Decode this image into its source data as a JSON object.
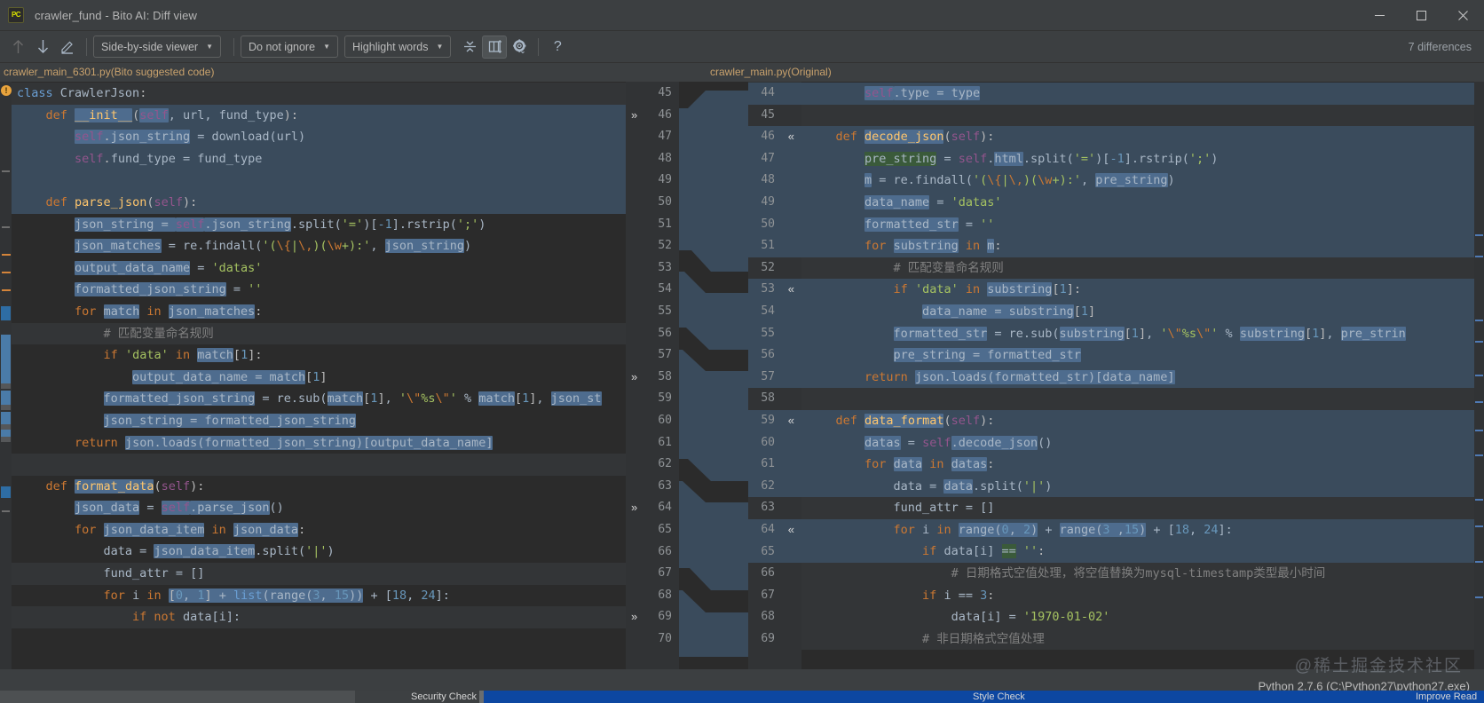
{
  "window": {
    "title": "crawler_fund - Bito AI: Diff view",
    "app_icon": "pycharm-icon",
    "minimize": "minimize-icon",
    "maximize": "maximize-icon",
    "close": "close-icon"
  },
  "toolbar": {
    "prev_diff": "arrow-up-icon",
    "next_diff": "arrow-down-icon",
    "edit": "pencil-icon",
    "viewer_mode": "Side-by-side viewer",
    "ignore_mode": "Do not ignore",
    "highlight_mode": "Highlight words",
    "collapse_unchanged": "collapse-icon",
    "toggle_panes": "columns-icon",
    "settings": "gear-icon",
    "help": "?",
    "differences": "7 differences",
    "caret": "▼"
  },
  "files": {
    "left": "crawler_main_6301.py(Bito suggested code)",
    "right": "crawler_main.py(Original)"
  },
  "status": {
    "interpreter": "Python 2.7.6 (C:\\Python27\\python27.exe)",
    "watermark": "@稀土掘金技术社区",
    "bottom_items": [
      "Security Check",
      "Style Check",
      "Improve Read"
    ]
  },
  "left_pane": {
    "lines": [
      {
        "n": "",
        "bg": "bg-ign",
        "html": "<span class='kw2'>class</span> <span class='id'>CrawlerJson</span>:"
      },
      {
        "n": "",
        "bg": "bg-add",
        "html": "    <span class='kw'>def</span> <span class='hl fn'>__init__</span>(<span class='hl self'>self</span><span class='id'>, url, fund_type</span>):"
      },
      {
        "n": "",
        "bg": "bg-add",
        "html": "        <span class='hl'><span class='self'>self</span>.<span class='id'>json_string</span></span> <span class='id'>= download(url)</span>"
      },
      {
        "n": "",
        "bg": "bg-add",
        "html": "        <span class='self'>self</span>.<span class='id'>fund_type = fund_type</span>"
      },
      {
        "n": "",
        "bg": "bg-add",
        "html": ""
      },
      {
        "n": "",
        "bg": "bg-add",
        "html": "    <span class='kw'>def</span> <span class='fn'>parse_json</span>(<span class='self'>self</span>):"
      },
      {
        "n": "",
        "bg": "bg-none",
        "html": "        <span class='hl id'>json_string = </span><span class='hl self'>self</span><span class='hl id'>.json_string</span><span class='id'>.split(</span><span class='str'>'='</span><span class='id'>)[</span><span class='num'>-1</span><span class='id'>].rstrip(</span><span class='str'>';'</span><span class='id'>)</span>"
      },
      {
        "n": "",
        "bg": "bg-none",
        "html": "        <span class='hl id'>json_matches</span> <span class='id'>= re.findall(</span><span class='str'>'(</span><span class='esc'>\\{</span><span class='str'>|</span><span class='esc'>\\,</span><span class='str'>)(</span><span class='esc'>\\w</span><span class='str'>+):'</span><span class='id'>, </span><span class='hl id'>json_string</span><span class='id'>)</span>"
      },
      {
        "n": "",
        "bg": "bg-none",
        "html": "        <span class='hl id'>output_data_name</span><span class='id'> = </span><span class='str'>'datas'</span>"
      },
      {
        "n": "",
        "bg": "bg-none",
        "html": "        <span class='hl id'>formatted_json_string</span><span class='id'> = </span><span class='str'>''</span>"
      },
      {
        "n": "",
        "bg": "bg-none",
        "html": "        <span class='kw'>for</span> <span class='hl id'>match</span> <span class='kw'>in</span> <span class='hl id'>json_matches</span>:"
      },
      {
        "n": "",
        "bg": "bg-ign",
        "html": "            <span class='cm'># 匹配变量命名规则</span>"
      },
      {
        "n": "",
        "bg": "bg-none",
        "html": "            <span class='kw'>if</span> <span class='str'>'data'</span> <span class='kw'>in</span> <span class='hl id'>match</span>[<span class='num'>1</span>]:"
      },
      {
        "n": "",
        "bg": "bg-none",
        "html": "                <span class='hl id'>output_data_name = match</span>[<span class='num'>1</span>]"
      },
      {
        "n": "",
        "bg": "bg-none",
        "html": "            <span class='hl id'>formatted_json_string</span><span class='id'> = re.sub(</span><span class='hl id'>match</span>[<span class='num'>1</span>]<span class='id'>, </span><span class='str'>'</span><span class='esc'>\\\"</span><span class='str'>%s</span><span class='esc'>\\\"</span><span class='str'>'</span><span class='id'> % </span><span class='hl id'>match</span>[<span class='num'>1</span>]<span class='id'>, </span><span class='hl id'>json_st</span>"
      },
      {
        "n": "",
        "bg": "bg-none",
        "html": "            <span class='hl id'>json_string = formatted_json_string</span>"
      },
      {
        "n": "",
        "bg": "bg-none",
        "html": "        <span class='kw'>return</span> <span class='hl id'>json.loads(formatted_json_string)[output_data_name]</span>"
      },
      {
        "n": "",
        "bg": "bg-ign",
        "html": ""
      },
      {
        "n": "",
        "bg": "bg-none",
        "html": "    <span class='kw'>def</span> <span class='hl fn'>format_data</span>(<span class='self'>self</span>):"
      },
      {
        "n": "",
        "bg": "bg-none",
        "html": "        <span class='hl id'>json_data</span><span class='id'> = </span><span class='hl self'>self</span><span class='hl id'>.parse_json</span><span class='id'>()</span>"
      },
      {
        "n": "",
        "bg": "bg-none",
        "html": "        <span class='kw'>for</span> <span class='hl id'>json_data_item</span> <span class='kw'>in</span> <span class='hl id'>json_data</span>:"
      },
      {
        "n": "",
        "bg": "bg-none",
        "html": "            <span class='id'>data = </span><span class='hl id'>json_data_item</span><span class='id'>.split(</span><span class='str'>'|'</span><span class='id'>)</span>"
      },
      {
        "n": "",
        "bg": "bg-ign",
        "html": "            <span class='id'>fund_attr = []</span>"
      },
      {
        "n": "",
        "bg": "bg-none",
        "html": "            <span class='kw'>for</span> <span class='id'>i</span> <span class='kw'>in</span> <span class='hl'>[<span class='num'>0</span><span class='id'>, </span><span class='num'>1</span>]<span class='id'> + </span><span class='kw2'>list</span><span class='id'>(range(</span><span class='num'>3</span><span class='id'>, </span><span class='num'>15</span><span class='id'>))</span></span><span class='id'> + [</span><span class='num'>18</span><span class='id'>, </span><span class='num'>24</span><span class='id'>]:</span>"
      },
      {
        "n": "",
        "bg": "bg-ign",
        "html": "                <span class='kw'>if not</span> <span class='id'>data[i]:</span>"
      }
    ]
  },
  "right_pane": {
    "lines": [
      {
        "ln": "44",
        "bg": "bg-add",
        "chev": "",
        "html": "        <span class='hl self'>self</span><span class='hl id'>.type = type</span>"
      },
      {
        "ln": "45",
        "bg": "bg-ign",
        "chev": "",
        "html": ""
      },
      {
        "ln": "46",
        "bg": "bg-add",
        "chev": "«",
        "html": "    <span class='kw'>def</span> <span class='hl fn'>decode_json</span>(<span class='self'>self</span>):"
      },
      {
        "ln": "47",
        "bg": "bg-add",
        "chev": "",
        "html": "        <span class='hlg id'>pre_string</span><span class='id'> = </span><span class='self'>self</span><span class='id'>.</span><span class='hl id'>html</span><span class='id'>.split(</span><span class='str'>'='</span><span class='id'>)[</span><span class='num'>-1</span><span class='id'>].rstrip(</span><span class='str'>';'</span><span class='id'>)</span>"
      },
      {
        "ln": "48",
        "bg": "bg-add",
        "chev": "",
        "html": "        <span class='hl id'>m</span><span class='id'> = re.findall(</span><span class='str'>'(</span><span class='esc'>\\{</span><span class='str'>|</span><span class='esc'>\\,</span><span class='str'>)(</span><span class='esc'>\\w</span><span class='str'>+):'</span><span class='id'>, </span><span class='hl id'>pre_string</span><span class='id'>)</span>"
      },
      {
        "ln": "49",
        "bg": "bg-add",
        "chev": "",
        "html": "        <span class='hl id'>data_name</span><span class='id'> = </span><span class='str'>'datas'</span>"
      },
      {
        "ln": "50",
        "bg": "bg-add",
        "chev": "",
        "html": "        <span class='hl id'>formatted_str</span><span class='id'> = </span><span class='str'>''</span>"
      },
      {
        "ln": "51",
        "bg": "bg-add",
        "chev": "",
        "html": "        <span class='kw'>for</span> <span class='hl id'>substring</span> <span class='kw'>in</span> <span class='hl id'>m</span>:"
      },
      {
        "ln": "52",
        "bg": "bg-ign",
        "chev": "",
        "html": "            <span class='cm'># 匹配变量命名规则</span>"
      },
      {
        "ln": "53",
        "bg": "bg-add",
        "chev": "«",
        "html": "            <span class='kw'>if</span> <span class='str'>'data'</span> <span class='kw'>in</span> <span class='hl id'>substring</span>[<span class='num'>1</span>]:"
      },
      {
        "ln": "54",
        "bg": "bg-add",
        "chev": "",
        "html": "                <span class='hl id'>data_name = substring</span>[<span class='num'>1</span>]"
      },
      {
        "ln": "55",
        "bg": "bg-add",
        "chev": "",
        "html": "            <span class='hl id'>formatted_str</span><span class='id'> = re.sub(</span><span class='hl id'>substring</span>[<span class='num'>1</span>]<span class='id'>, </span><span class='str'>'</span><span class='esc'>\\\"</span><span class='str'>%s</span><span class='esc'>\\\"</span><span class='str'>'</span><span class='id'> % </span><span class='hl id'>substring</span>[<span class='num'>1</span>]<span class='id'>, </span><span class='hl id'>pre_strin</span>"
      },
      {
        "ln": "56",
        "bg": "bg-add",
        "chev": "",
        "html": "            <span class='hl id'>pre_string = formatted_str</span>"
      },
      {
        "ln": "57",
        "bg": "bg-add",
        "chev": "",
        "html": "        <span class='kw'>return</span> <span class='hl id'>json.loads(formatted_str)[data_name]</span>"
      },
      {
        "ln": "58",
        "bg": "bg-ign",
        "chev": "",
        "html": ""
      },
      {
        "ln": "59",
        "bg": "bg-add",
        "chev": "«",
        "html": "    <span class='kw'>def</span> <span class='hl fn'>data_format</span>(<span class='self'>self</span>):"
      },
      {
        "ln": "60",
        "bg": "bg-add",
        "chev": "",
        "html": "        <span class='hl id'>datas</span><span class='id'> = </span><span class='self'>self</span><span class='hl id'>.decode_json</span><span class='id'>()</span>"
      },
      {
        "ln": "61",
        "bg": "bg-add",
        "chev": "",
        "html": "        <span class='kw'>for</span> <span class='hl id'>data</span> <span class='kw'>in</span> <span class='hl id'>datas</span>:"
      },
      {
        "ln": "62",
        "bg": "bg-add",
        "chev": "",
        "html": "            <span class='id'>data = </span><span class='hl id'>data</span><span class='id'>.split(</span><span class='str'>'|'</span><span class='id'>)</span>"
      },
      {
        "ln": "63",
        "bg": "bg-ign",
        "chev": "",
        "html": "            <span class='id'>fund_attr = []</span>"
      },
      {
        "ln": "64",
        "bg": "bg-add",
        "chev": "«",
        "html": "            <span class='kw'>for</span> <span class='id'>i</span> <span class='kw'>in</span> <span class='hl'><span class='id'>range(</span><span class='num'>0</span><span class='id'>, </span><span class='num'>2</span><span class='id'>)</span></span><span class='id'> + </span><span class='hl'><span class='id'>range(</span><span class='num'>3</span> <span class='id'>,</span><span class='num'>15</span><span class='id'>)</span></span><span class='id'> + [</span><span class='num'>18</span><span class='id'>, </span><span class='num'>24</span><span class='id'>]:</span>"
      },
      {
        "ln": "65",
        "bg": "bg-add",
        "chev": "",
        "html": "                <span class='kw'>if</span> <span class='id'>data[i]</span> <span class='hlg id'>==</span> <span class='str'>''</span>:"
      },
      {
        "ln": "66",
        "bg": "bg-ign",
        "chev": "",
        "html": "                    <span class='cm'># 日期格式空值处理，将空值替换为mysql-timestamp类型最小时间</span>"
      },
      {
        "ln": "67",
        "bg": "bg-ign",
        "chev": "",
        "html": "                <span class='kw'>if</span> <span class='id'>i ==</span> <span class='num'>3</span>:"
      },
      {
        "ln": "68",
        "bg": "bg-ign",
        "chev": "",
        "html": "                    <span class='id'>data[i] = </span><span class='str'>'1970-01-02'</span>"
      },
      {
        "ln": "69",
        "bg": "bg-ign",
        "chev": "",
        "html": "                <span class='cm'># 非日期格式空值处理</span>"
      }
    ]
  },
  "left_gutter": {
    "numbers": [
      "45",
      "46",
      "47",
      "48",
      "49",
      "50",
      "51",
      "52",
      "53",
      "54",
      "55",
      "56",
      "57",
      "58",
      "59",
      "60",
      "61",
      "62",
      "63",
      "64",
      "65",
      "66",
      "67",
      "68",
      "69",
      "70"
    ],
    "chevrons": {
      "1": "»",
      "13": "»",
      "19": "»",
      "24": "»"
    }
  }
}
